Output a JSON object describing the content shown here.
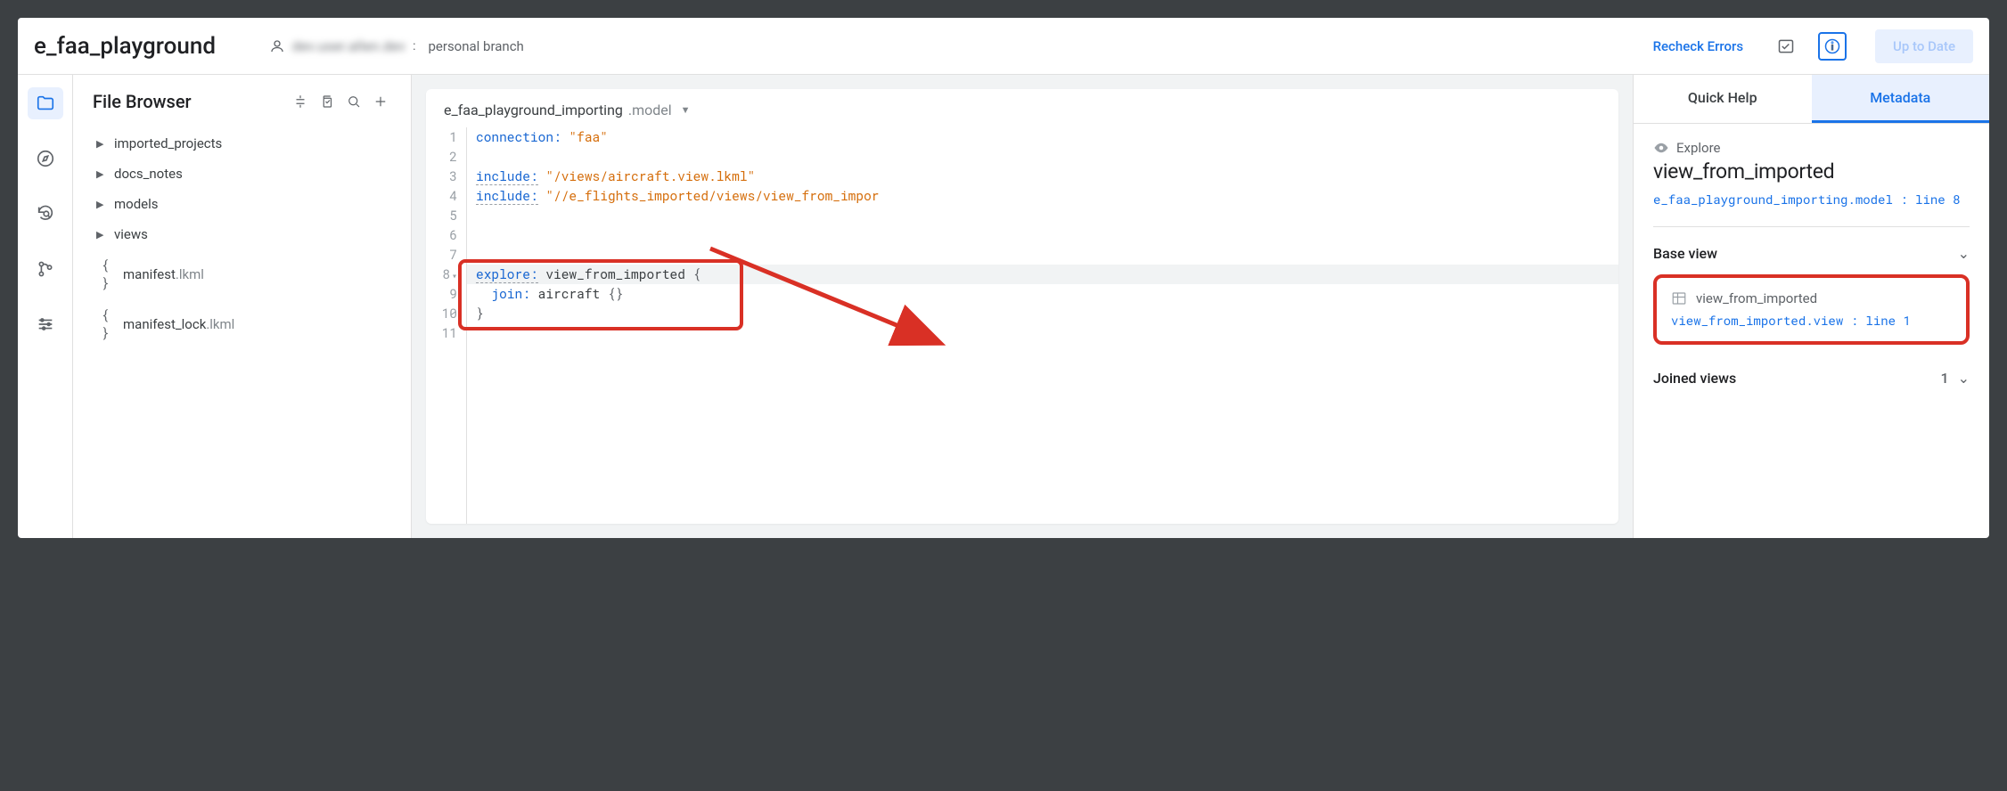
{
  "header": {
    "project_title": "e_faa_playground",
    "branch_label": "personal branch",
    "recheck_label": "Recheck Errors",
    "uptodate_label": "Up to Date"
  },
  "file_browser": {
    "title": "File Browser",
    "items": [
      {
        "type": "folder",
        "label": "imported_projects"
      },
      {
        "type": "folder",
        "label": "docs_notes"
      },
      {
        "type": "folder",
        "label": "models"
      },
      {
        "type": "folder",
        "label": "views"
      },
      {
        "type": "file",
        "label": "manifest",
        "ext": ".lkml"
      },
      {
        "type": "file",
        "label": "manifest_lock",
        "ext": ".lkml"
      }
    ]
  },
  "editor": {
    "filename_main": "e_faa_playground_importing",
    "filename_ext": ".model",
    "lines": {
      "l1_key": "connection:",
      "l1_val": "\"faa\"",
      "l3_key": "include:",
      "l3_val": "\"/views/aircraft.view.lkml\"",
      "l4_key": "include:",
      "l4_val": "\"//e_flights_imported/views/view_from_impor",
      "l8_key": "explore:",
      "l8_ident": "view_from_imported",
      "l8_brace": "{",
      "l9_key": "join:",
      "l9_ident": "aircraft",
      "l9_brace": "{}",
      "l10_brace": "}"
    }
  },
  "meta": {
    "tab_quickhelp": "Quick Help",
    "tab_metadata": "Metadata",
    "eyebrow": "Explore",
    "title": "view_from_imported",
    "model_link": "e_faa_playground_importing.model : line 8",
    "section_baseview": "Base view",
    "baseview_name": "view_from_imported",
    "baseview_link": "view_from_imported.view : line 1",
    "section_joined": "Joined views",
    "joined_count": "1"
  }
}
